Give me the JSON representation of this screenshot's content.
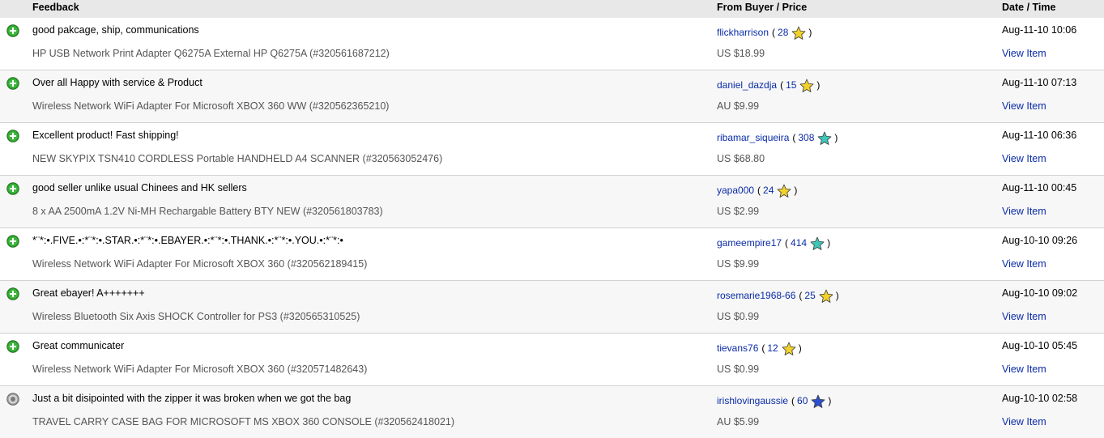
{
  "header": {
    "feedback": "Feedback",
    "buyer_price": "From Buyer / Price",
    "date_time": "Date / Time"
  },
  "rows": [
    {
      "rating": "positive",
      "comment": "good pakcage, ship, communications",
      "item": "HP USB Network Print Adapter Q6275A External HP Q6275A (#320561687212)",
      "buyer": "flickharrison",
      "score": "28",
      "star_color": "#f2d22a",
      "price": "US $18.99",
      "date": "Aug-11-10 10:06",
      "view": "View Item"
    },
    {
      "rating": "positive",
      "comment": "Over all Happy with service & Product",
      "item": "Wireless Network WiFi Adapter For Microsoft XBOX 360 WW (#320562365210)",
      "buyer": "daniel_dazdja",
      "score": "15",
      "star_color": "#f2d22a",
      "price": "AU $9.99",
      "date": "Aug-11-10 07:13",
      "view": "View Item"
    },
    {
      "rating": "positive",
      "comment": "Excellent product! Fast shipping!",
      "item": "NEW SKYPIX TSN410 CORDLESS Portable HANDHELD A4 SCANNER (#320563052476)",
      "buyer": "ribamar_siqueira",
      "score": "308",
      "star_color": "#3cc7b8",
      "price": "US $68.80",
      "date": "Aug-11-10 06:36",
      "view": "View Item"
    },
    {
      "rating": "positive",
      "comment": "good seller unlike usual Chinees and HK sellers",
      "item": "8 x AA 2500mA 1.2V Ni-MH Rechargable Battery BTY NEW (#320561803783)",
      "buyer": "yapa000",
      "score": "24",
      "star_color": "#f2d22a",
      "price": "US $2.99",
      "date": "Aug-11-10 00:45",
      "view": "View Item"
    },
    {
      "rating": "positive",
      "comment": "*¨*:•.FIVE.•:*¨*:•.STAR.•:*¨*:•.EBAYER.•:*¨*:•.THANK.•:*¨*:•.YOU.•:*¨*:•",
      "item": "Wireless Network WiFi Adapter For Microsoft XBOX 360 (#320562189415)",
      "buyer": "gameempire17",
      "score": "414",
      "star_color": "#3cc7b8",
      "price": "US $9.99",
      "date": "Aug-10-10 09:26",
      "view": "View Item"
    },
    {
      "rating": "positive",
      "comment": "Great ebayer! A+++++++",
      "item": "Wireless Bluetooth Six Axis SHOCK Controller for PS3 (#320565310525)",
      "buyer": "rosemarie1968-66",
      "score": "25",
      "star_color": "#f2d22a",
      "price": "US $0.99",
      "date": "Aug-10-10 09:02",
      "view": "View Item"
    },
    {
      "rating": "positive",
      "comment": "Great communicater",
      "item": "Wireless Network WiFi Adapter For Microsoft XBOX 360 (#320571482643)",
      "buyer": "tievans76",
      "score": "12",
      "star_color": "#f2d22a",
      "price": "US $0.99",
      "date": "Aug-10-10 05:45",
      "view": "View Item"
    },
    {
      "rating": "neutral",
      "comment": "Just a bit disipointed with the zipper it was broken when we got the bag",
      "item": "TRAVEL CARRY CASE BAG FOR MICROSOFT MS XBOX 360 CONSOLE (#320562418021)",
      "buyer": "irishlovingaussie",
      "score": "60",
      "star_color": "#2a4fd0",
      "price": "AU $5.99",
      "date": "Aug-10-10 02:58",
      "view": "View Item"
    }
  ]
}
